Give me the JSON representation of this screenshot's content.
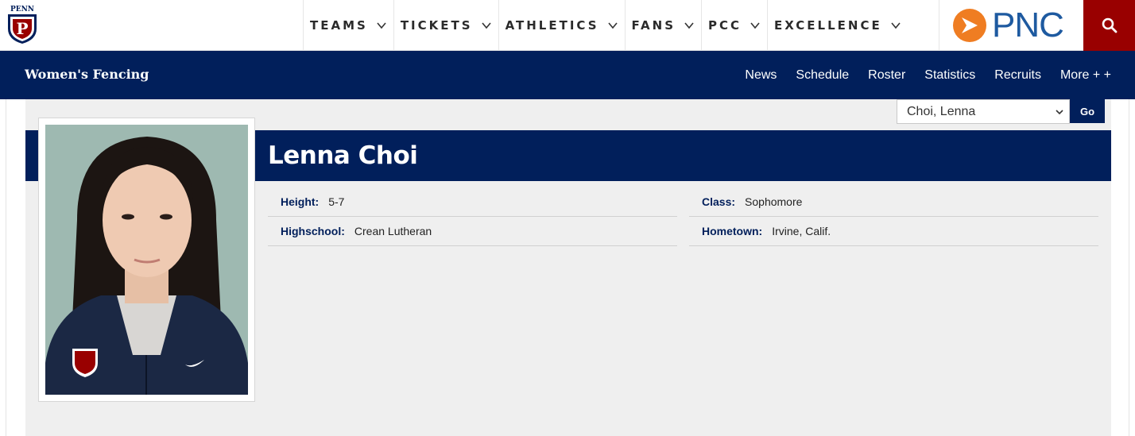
{
  "header": {
    "logo_text": "PENN",
    "nav": [
      "TEAMS",
      "TICKETS",
      "ATHLETICS",
      "FANS",
      "PCC",
      "EXCELLENCE"
    ],
    "sponsor": "PNC"
  },
  "subnav": {
    "sport": "Women's Fencing",
    "links": [
      "News",
      "Schedule",
      "Roster",
      "Statistics",
      "Recruits"
    ],
    "more": "More + +"
  },
  "roster_select": {
    "value": "Choi, Lenna",
    "go": "Go"
  },
  "player": {
    "name": "Lenna Choi",
    "fields": {
      "height": {
        "label": "Height:",
        "value": "5-7"
      },
      "class": {
        "label": "Class:",
        "value": "Sophomore"
      },
      "highschool": {
        "label": "Highschool:",
        "value": "Crean Lutheran"
      },
      "hometown": {
        "label": "Hometown:",
        "value": "Irvine, Calif."
      }
    }
  },
  "colors": {
    "navy": "#011f5b",
    "red": "#990000",
    "pnc_orange": "#ef7d22",
    "pnc_blue": "#1e5aa0"
  }
}
